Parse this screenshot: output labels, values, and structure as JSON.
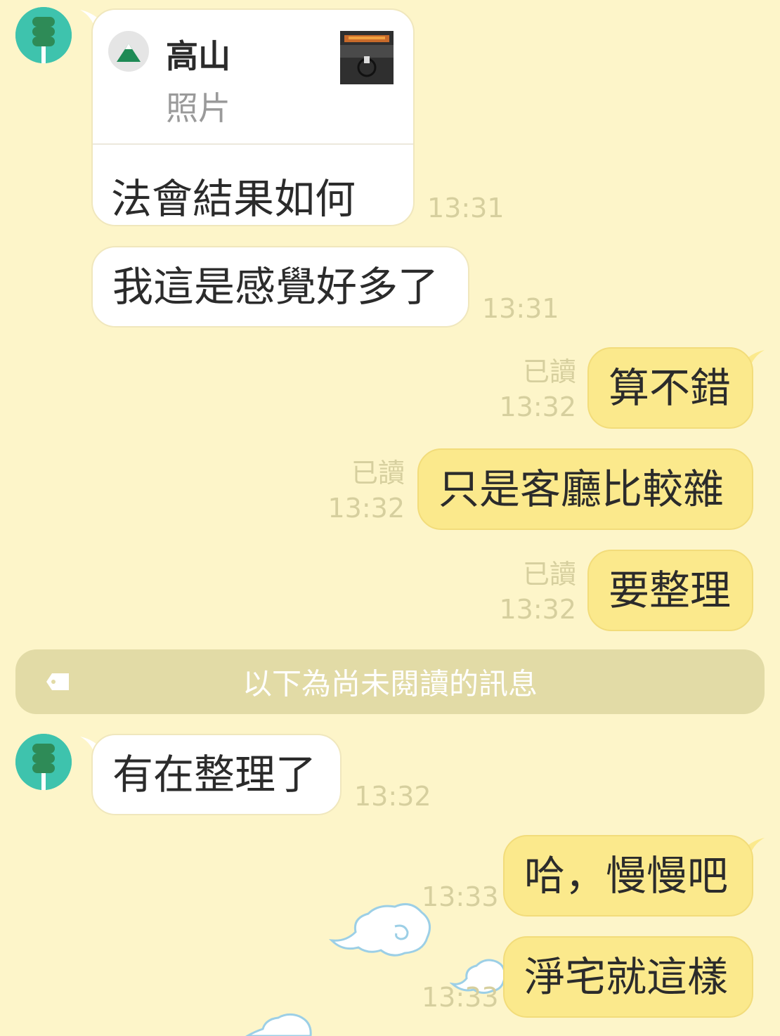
{
  "messages": {
    "m1": {
      "reply_to": {
        "name": "高山",
        "sub": "照片"
      },
      "text": "法會結果如何",
      "time": "13:31"
    },
    "m2": {
      "text": "我這是感覺好多了",
      "time": "13:31"
    },
    "m3": {
      "text": "算不錯",
      "read": "已讀",
      "time": "13:32"
    },
    "m4": {
      "text": "只是客廳比較雜",
      "read": "已讀",
      "time": "13:32"
    },
    "m5": {
      "text": "要整理",
      "read": "已讀",
      "time": "13:32"
    },
    "m6": {
      "text": "有在整理了",
      "time": "13:32"
    },
    "m7": {
      "text": "哈，慢慢吧",
      "time": "13:33"
    },
    "m8": {
      "text": "淨宅就這樣",
      "time": "13:33"
    }
  },
  "unread_divider": {
    "label": "以下為尚未閱讀的訊息",
    "icon": "tag-icon"
  },
  "colors": {
    "background": "#fdf5c9",
    "incoming_bubble": "#ffffff",
    "outgoing_bubble": "#fbe98c",
    "avatar": "#3ec3ad",
    "divider": "#e2dba6"
  }
}
